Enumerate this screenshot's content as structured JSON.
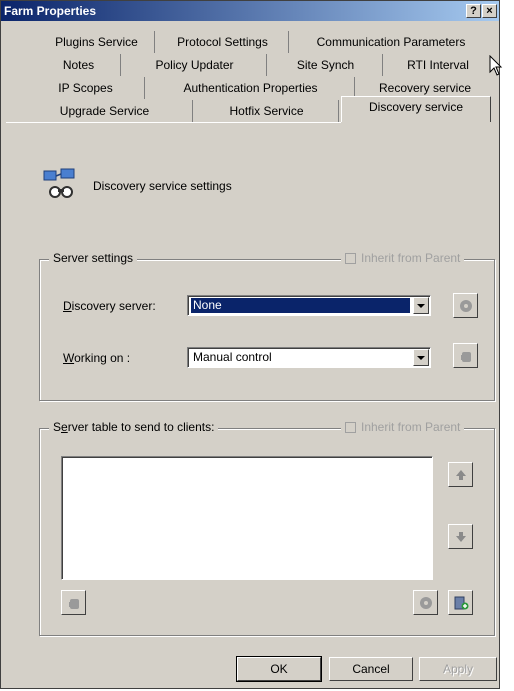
{
  "window": {
    "title": "Farm Properties",
    "help_label": "?",
    "close_label": "×"
  },
  "tabs": {
    "row1": [
      "Plugins Service",
      "Protocol Settings",
      "Communication Parameters"
    ],
    "row2": [
      "Notes",
      "Policy Updater",
      "Site Synch",
      "RTI Interval"
    ],
    "row3": [
      "IP Scopes",
      "Authentication Properties",
      "Recovery service"
    ],
    "row4": [
      "Upgrade Service",
      "Hotfix Service",
      "Discovery service"
    ],
    "active": "Discovery service"
  },
  "header": {
    "label": "Discovery service settings",
    "icon": "network-discovery-icon"
  },
  "server_settings": {
    "title": "Server settings",
    "inherit_label": "Inherit from Parent",
    "inherit_checked": false,
    "discovery_server_label": "Discovery server:",
    "discovery_server_value": "None",
    "working_on_label": "Working on :",
    "working_on_value": "Manual control"
  },
  "server_table": {
    "title": "Server table to send to clients:",
    "inherit_label": "Inherit from Parent",
    "inherit_checked": false,
    "items": []
  },
  "buttons": {
    "ok": "OK",
    "cancel": "Cancel",
    "apply": "Apply"
  },
  "colors": {
    "face": "#d4d0c8",
    "title_start": "#0a246a",
    "title_end": "#a6caf0",
    "selection": "#0a246a",
    "disabled_text": "#a0a0a0"
  }
}
